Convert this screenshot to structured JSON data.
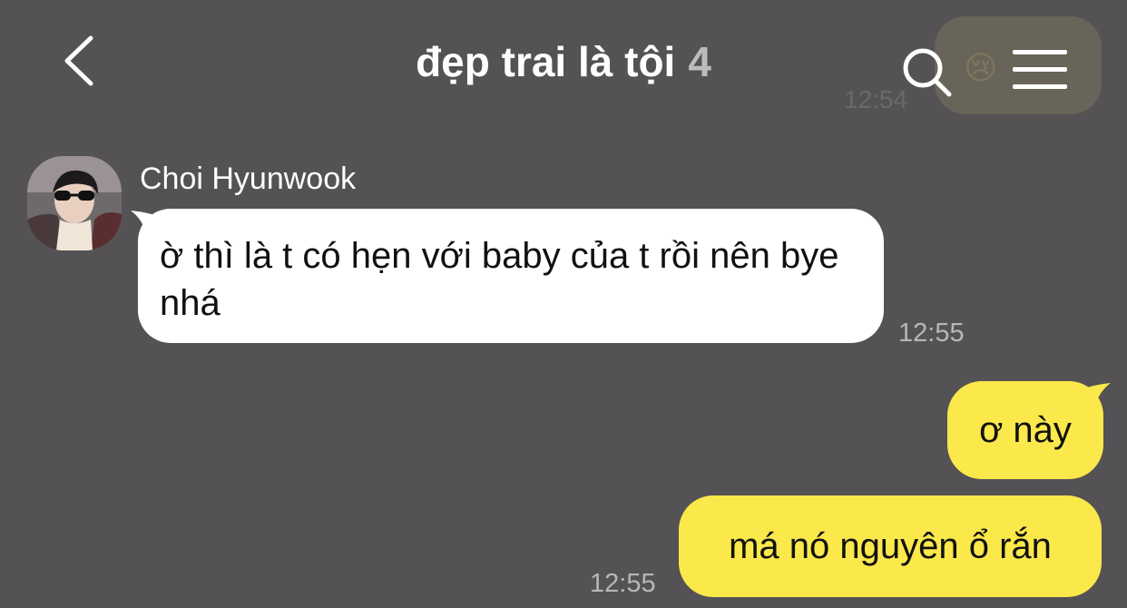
{
  "header": {
    "title": "đẹp trai là tội",
    "member_count": "4",
    "back_icon": "chevron-left-icon",
    "search_icon": "search-icon",
    "menu_icon": "hamburger-menu-icon"
  },
  "pinned_overlay": {
    "emoji": "😢",
    "time": "12:54"
  },
  "messages": [
    {
      "direction": "incoming",
      "sender": "Choi Hyunwook",
      "text": "ờ thì là t có hẹn với baby của t rồi nên bye nhá",
      "time": "12:55"
    },
    {
      "direction": "outgoing",
      "text": "ơ này"
    },
    {
      "direction": "outgoing",
      "text": "má nó nguyên ổ rắn",
      "time": "12:55"
    }
  ],
  "colors": {
    "background": "#545254",
    "incoming_bubble": "#ffffff",
    "outgoing_bubble": "#fbe84a",
    "timestamp": "#b8b6b8"
  }
}
